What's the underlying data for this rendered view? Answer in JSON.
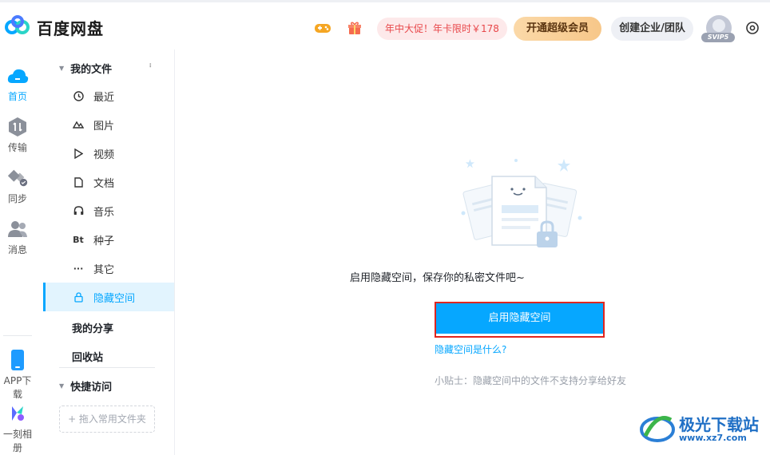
{
  "header": {
    "app_name": "百度网盘",
    "promo": "年中大促！年卡限时￥178",
    "vip_button": "开通超级会员",
    "enterprise_button": "创建企业/团队",
    "svip_badge": "SVIP5",
    "icons": [
      "gamepad-icon",
      "gift-icon",
      "settings-icon"
    ]
  },
  "rail": {
    "items": [
      {
        "label": "首页",
        "icon": "cloud-home-icon"
      },
      {
        "label": "传输",
        "icon": "transfer-icon"
      },
      {
        "label": "同步",
        "icon": "sync-icon"
      },
      {
        "label": "消息",
        "icon": "message-icon"
      },
      {
        "label": "APP下载",
        "icon": "phone-icon"
      },
      {
        "label": "一刻相册",
        "icon": "album-icon"
      }
    ]
  },
  "sidebar": {
    "my_files": "我的文件",
    "items": [
      {
        "label": "最近",
        "icon": "clock-icon"
      },
      {
        "label": "图片",
        "icon": "image-icon"
      },
      {
        "label": "视频",
        "icon": "play-icon"
      },
      {
        "label": "文档",
        "icon": "document-icon"
      },
      {
        "label": "音乐",
        "icon": "headphones-icon"
      },
      {
        "label": "种子",
        "icon": "bt-icon",
        "glyph": "Bt"
      },
      {
        "label": "其它",
        "icon": "more-icon",
        "glyph": "···"
      },
      {
        "label": "隐藏空间",
        "icon": "lock-icon"
      }
    ],
    "my_share": "我的分享",
    "recycle_bin": "回收站",
    "quick_access": "快捷访问",
    "drop_hint": "+ 拖入常用文件夹"
  },
  "main": {
    "empty_text": "启用隐藏空间，保存你的私密文件吧~",
    "enable_button": "启用隐藏空间",
    "what_link": "隐藏空间是什么?",
    "tip": "小贴士：隐藏空间中的文件不支持分享给好友"
  },
  "watermark": {
    "title": "极光下载站",
    "url": "www.xz7.com"
  },
  "colors": {
    "accent": "#06a7ff",
    "promo_text": "#e8474a",
    "highlight_border": "#e0261f"
  }
}
